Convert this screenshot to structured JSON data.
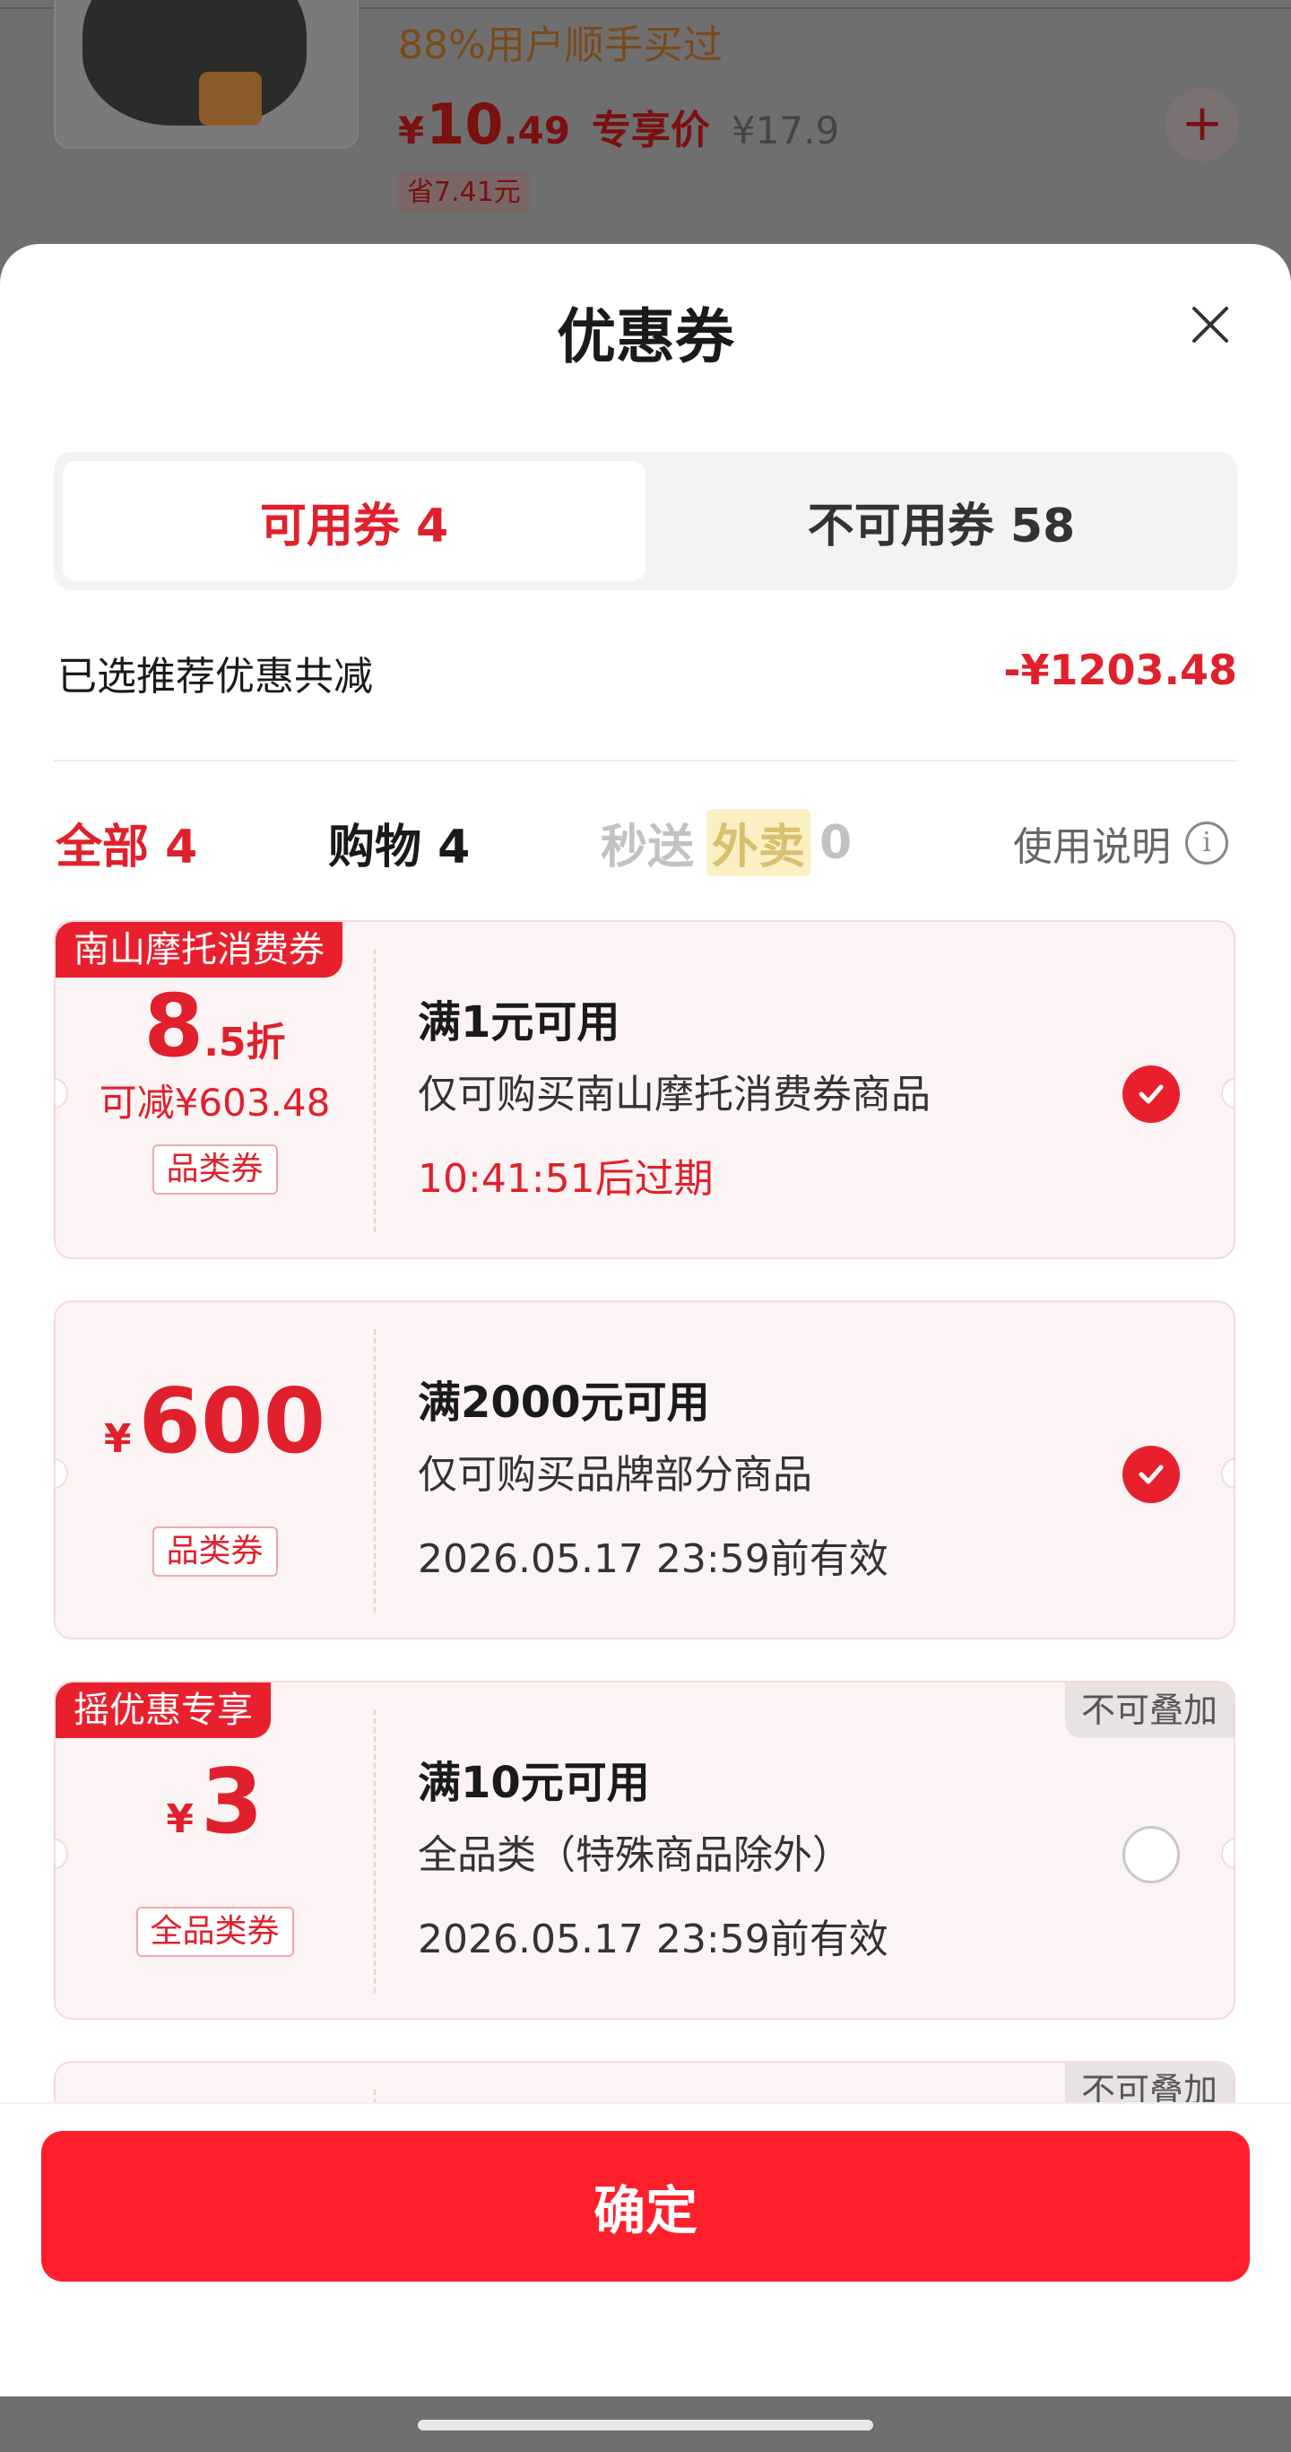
{
  "background_product": {
    "social_proof": "88%用户顺手买过",
    "price_yen": "¥",
    "price_int": "10",
    "price_dec": ".49",
    "price_tag": "专享价",
    "original_price": "¥17.9",
    "save_label": "省7.41元",
    "add_icon": "+"
  },
  "sheet": {
    "title": "优惠券",
    "close_icon": "close-icon"
  },
  "tabs": {
    "available": "可用券 4",
    "unavailable": "不可用券 58"
  },
  "summary": {
    "label": "已选推荐优惠共减",
    "amount": "-¥1203.48"
  },
  "filters": {
    "all": "全部 4",
    "shopping": "购物 4",
    "fast_prefix": "秒送",
    "fast_takeout": "外卖",
    "fast_count": "0",
    "usage": "使用说明",
    "info_glyph": "i"
  },
  "coupons": [
    {
      "badge": "南山摩托消费券",
      "discount_big": "8",
      "discount_small": ".5折",
      "saving": "可减¥603.48",
      "tag": "品类券",
      "title": "满1元可用",
      "desc": "仅可购买南山摩托消费券商品",
      "expiry": "10:41:51后过期",
      "selected": true
    },
    {
      "amount_yen": "¥",
      "amount": "600",
      "tag": "品类券",
      "title": "满2000元可用",
      "desc": "仅可购买品牌部分商品",
      "expiry": "2026.05.17 23:59前有效",
      "selected": true
    },
    {
      "badge": "摇优惠专享",
      "nostack": "不可叠加",
      "amount_yen": "¥",
      "amount": "3",
      "tag": "全品类券",
      "title": "满10元可用",
      "desc": "全品类（特殊商品除外）",
      "expiry": "2026.05.17 23:59前有效",
      "selected": false
    },
    {
      "nostack": "不可叠加"
    }
  ],
  "footer": {
    "confirm": "确定"
  },
  "colors": {
    "accent": "#e0202c",
    "button": "#fe1f2d",
    "coupon_bg": "#fcf4f4"
  }
}
